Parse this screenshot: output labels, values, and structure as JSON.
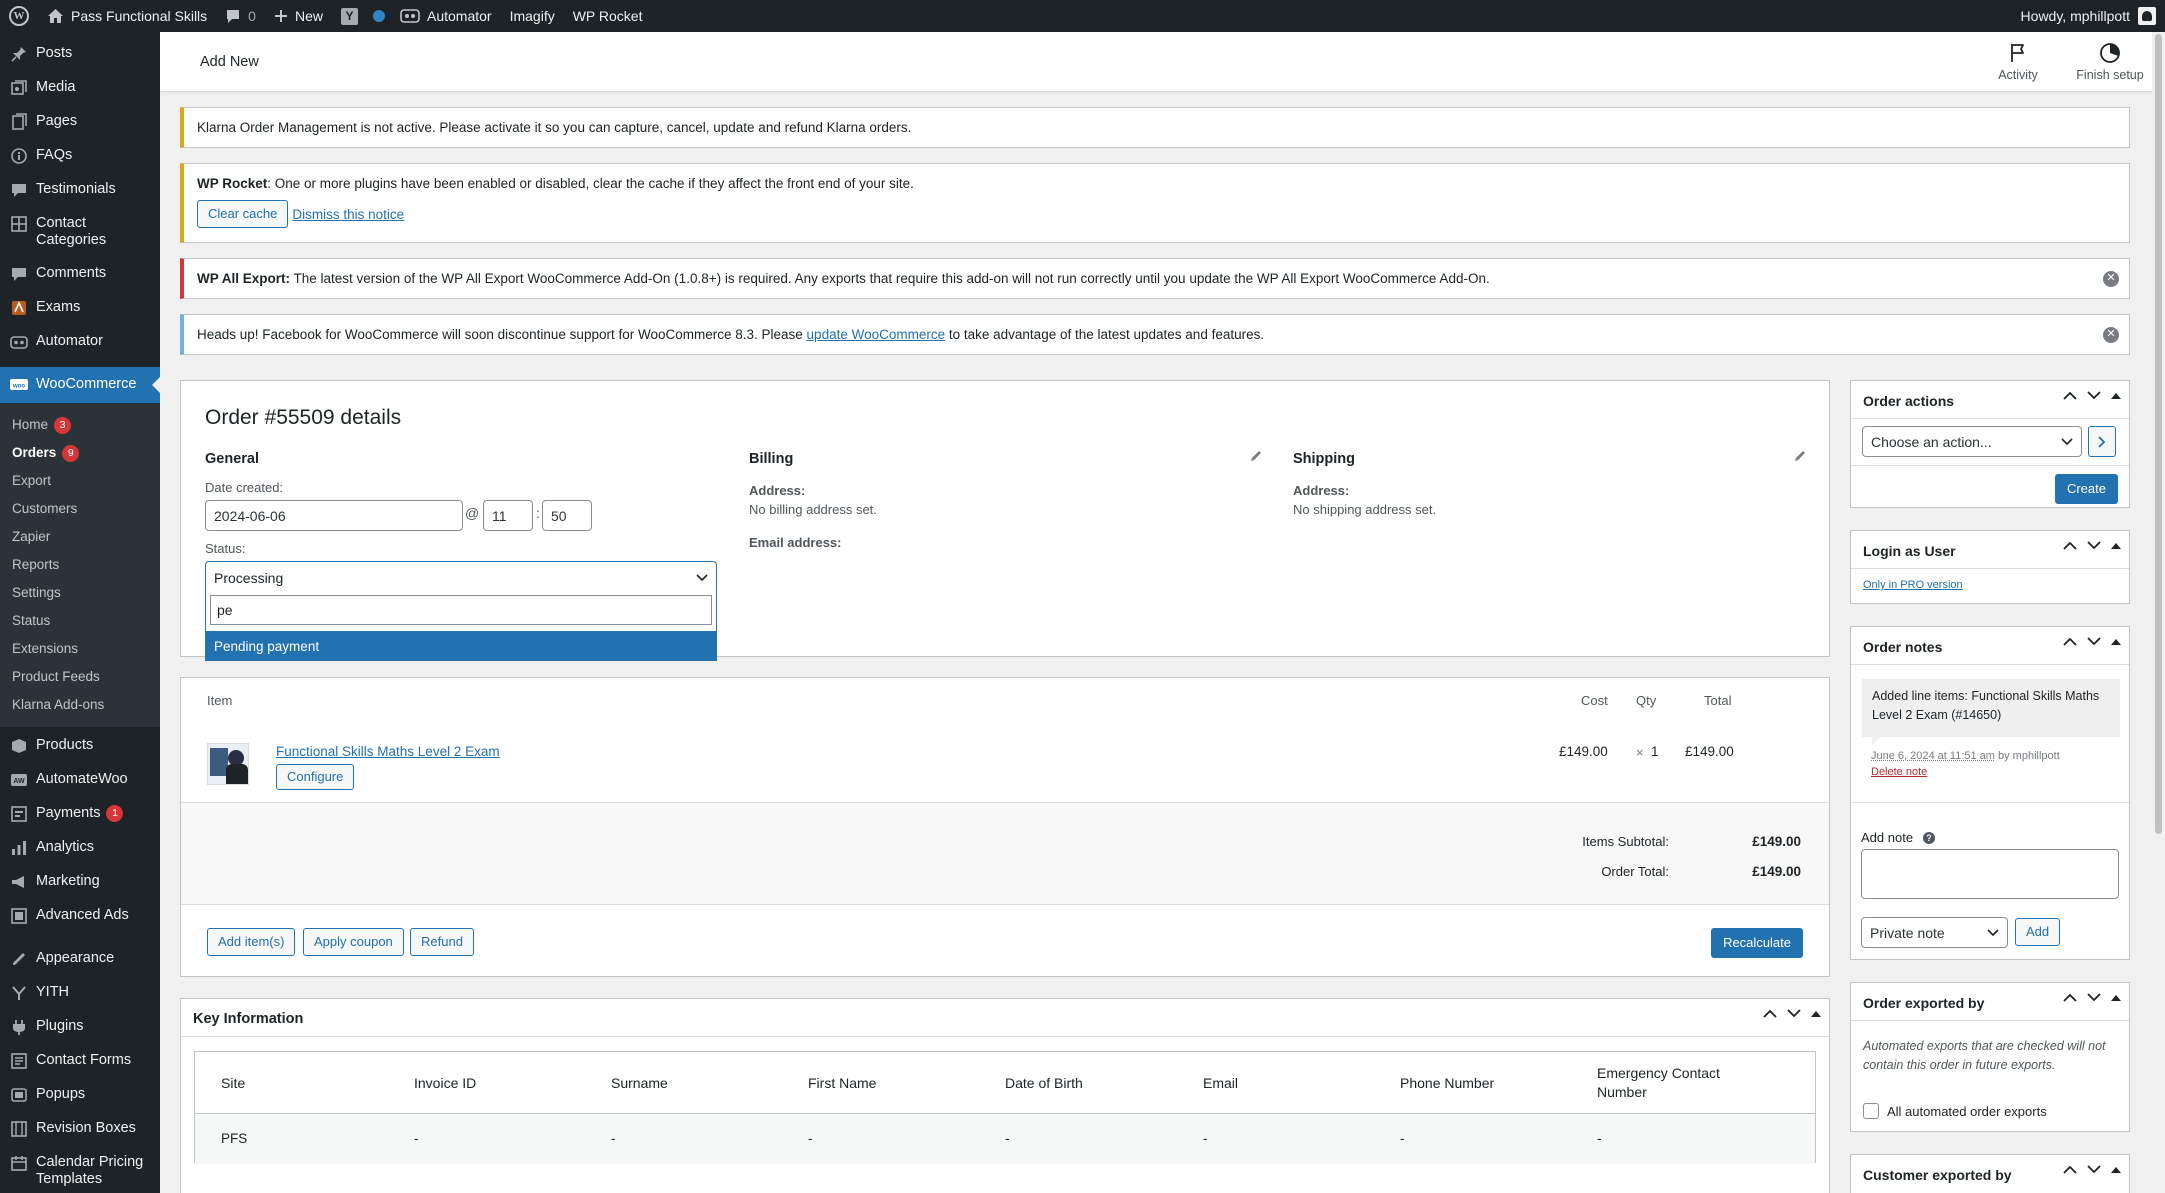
{
  "admin_bar": {
    "site_name": "Pass Functional Skills",
    "comments_count": "0",
    "new_label": "New",
    "automator_label": "Automator",
    "imagify_label": "Imagify",
    "wp_rocket_label": "WP Rocket",
    "howdy": "Howdy, mphillpott"
  },
  "sidebar": {
    "items_top": [
      {
        "label": "Posts",
        "icon": "pin-icon"
      },
      {
        "label": "Media",
        "icon": "media-icon"
      },
      {
        "label": "Pages",
        "icon": "pages-icon"
      },
      {
        "label": "FAQs",
        "icon": "info-icon"
      },
      {
        "label": "Testimonials",
        "icon": "testimonial-icon"
      },
      {
        "label": "Contact Categories",
        "icon": "grid-icon"
      },
      {
        "label": "Comments",
        "icon": "comment-icon"
      },
      {
        "label": "Exams",
        "icon": "exam-icon"
      },
      {
        "label": "Automator",
        "icon": "automator-icon"
      }
    ],
    "woocommerce_label": "WooCommerce",
    "woo_sub": [
      {
        "label": "Home",
        "badge": "3"
      },
      {
        "label": "Orders",
        "badge": "9"
      },
      {
        "label": "Export",
        "badge": ""
      },
      {
        "label": "Customers",
        "badge": ""
      },
      {
        "label": "Zapier",
        "badge": ""
      },
      {
        "label": "Reports",
        "badge": ""
      },
      {
        "label": "Settings",
        "badge": ""
      },
      {
        "label": "Status",
        "badge": ""
      },
      {
        "label": "Extensions",
        "badge": ""
      },
      {
        "label": "Product Feeds",
        "badge": ""
      },
      {
        "label": "Klarna Add-ons",
        "badge": ""
      }
    ],
    "items_mid": [
      {
        "label": "Products",
        "icon": "products-icon",
        "badge": ""
      },
      {
        "label": "AutomateWoo",
        "icon": "automatewoo-icon",
        "badge": ""
      },
      {
        "label": "Payments",
        "icon": "payments-icon",
        "badge": "1"
      },
      {
        "label": "Analytics",
        "icon": "analytics-icon",
        "badge": ""
      },
      {
        "label": "Marketing",
        "icon": "marketing-icon",
        "badge": ""
      },
      {
        "label": "Advanced Ads",
        "icon": "ads-icon",
        "badge": ""
      }
    ],
    "items_bottom": [
      {
        "label": "Appearance",
        "icon": "appearance-icon"
      },
      {
        "label": "YITH",
        "icon": "yith-icon"
      },
      {
        "label": "Plugins",
        "icon": "plugins-icon"
      },
      {
        "label": "Contact Forms",
        "icon": "forms-icon"
      },
      {
        "label": "Popups",
        "icon": "popups-icon"
      },
      {
        "label": "Revision Boxes",
        "icon": "revision-icon"
      },
      {
        "label": "Calendar Pricing Templates",
        "icon": "calendar-icon"
      }
    ]
  },
  "header": {
    "title": "Add New",
    "activity_label": "Activity",
    "finish_setup_label": "Finish setup"
  },
  "notices": {
    "klarna": "Klarna Order Management is not active. Please activate it so you can capture, cancel, update and refund Klarna orders.",
    "rocket_bold": "WP Rocket",
    "rocket_text": ": One or more plugins have been enabled or disabled, clear the cache if they affect the front end of your site.",
    "rocket_clear": "Clear cache",
    "rocket_dismiss": "Dismiss this notice",
    "export_bold": "WP All Export:",
    "export_text": " The latest version of the WP All Export WooCommerce Add-On (1.0.8+) is required. Any exports that require this add-on will not run correctly until you update the WP All Export WooCommerce Add-On.",
    "fb_text_1": "Heads up! Facebook for WooCommerce will soon discontinue support for WooCommerce 8.3. Please ",
    "fb_link": "update WooCommerce",
    "fb_text_2": " to take advantage of the latest updates and features."
  },
  "order": {
    "title": "Order #55509 details",
    "general_heading": "General",
    "date_created_label": "Date created:",
    "date_value": "2024-06-06",
    "at_sign": "@",
    "hour": "11",
    "colon": ":",
    "minute": "50",
    "status_label": "Status:",
    "status_value": "Processing",
    "status_search": "pe",
    "status_option": "Pending payment",
    "billing_heading": "Billing",
    "billing_address_label": "Address:",
    "billing_address_value": "No billing address set.",
    "billing_email_label": "Email address:",
    "shipping_heading": "Shipping",
    "shipping_address_label": "Address:",
    "shipping_address_value": "No shipping address set."
  },
  "items": {
    "col_item": "Item",
    "col_cost": "Cost",
    "col_qty": "Qty",
    "col_total": "Total",
    "row": {
      "name": "Functional Skills Maths Level 2 Exam",
      "configure": "Configure",
      "cost": "£149.00",
      "qty_x": "×",
      "qty": "1",
      "total": "£149.00"
    },
    "subtotal_label": "Items Subtotal:",
    "subtotal_value": "£149.00",
    "order_total_label": "Order Total:",
    "order_total_value": "£149.00",
    "add_items": "Add item(s)",
    "apply_coupon": "Apply coupon",
    "refund": "Refund",
    "recalculate": "Recalculate"
  },
  "key_info": {
    "title": "Key Information",
    "headers": [
      "Site",
      "Invoice ID",
      "Surname",
      "First Name",
      "Date of Birth",
      "Email",
      "Phone Number",
      "Emergency Contact Number"
    ],
    "row": [
      "PFS",
      "-",
      "-",
      "-",
      "-",
      "-",
      "-",
      "-"
    ]
  },
  "order_actions": {
    "title": "Order actions",
    "select_value": "Choose an action...",
    "create": "Create"
  },
  "login_as_user": {
    "title": "Login as User",
    "link": "Only in PRO version"
  },
  "order_notes": {
    "title": "Order notes",
    "note_text": "Added line items: Functional Skills Maths Level 2 Exam (#14650)",
    "note_date": "June 6, 2024 at 11:51 am",
    "note_by": " by mphillpott",
    "delete_note": "Delete note",
    "add_note_label": "Add note",
    "note_type": "Private note",
    "add_button": "Add"
  },
  "order_exported_by": {
    "title": "Order exported by",
    "description": "Automated exports that are checked will not contain this order in future exports.",
    "checkbox_label": "All automated order exports"
  },
  "customer_exported_by": {
    "title": "Customer exported by"
  }
}
